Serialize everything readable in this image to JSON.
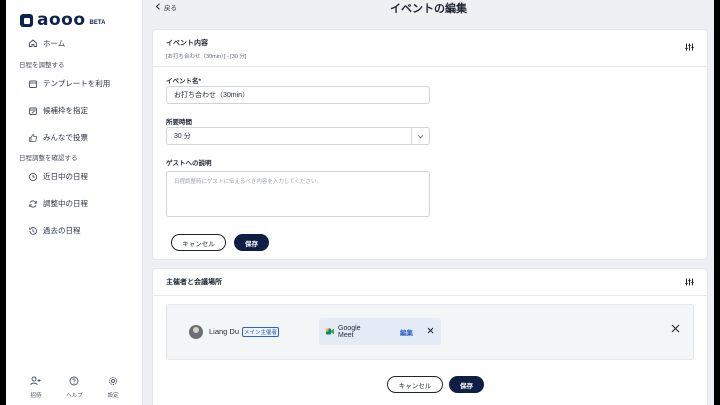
{
  "app": {
    "logo_text": "aooo",
    "logo_beta": "BETA"
  },
  "sidebar": {
    "home": "ホーム",
    "section_adjust": "日程を調整する",
    "adjust_items": [
      {
        "label": "テンプレートを利用",
        "icon": "calendar-icon"
      },
      {
        "label": "候補枠を指定",
        "icon": "calendar-edit-icon"
      },
      {
        "label": "みんなで投票",
        "icon": "thumbs-up-icon"
      }
    ],
    "section_confirm": "日程調整を確認する",
    "confirm_items": [
      {
        "label": "近日中の日程",
        "icon": "clock-icon"
      },
      {
        "label": "調整中の日程",
        "icon": "sync-icon"
      },
      {
        "label": "過去の日程",
        "icon": "history-icon"
      }
    ],
    "bottom": [
      {
        "label": "招待",
        "icon": "invite-icon"
      },
      {
        "label": "ヘルプ",
        "icon": "help-icon"
      },
      {
        "label": "設定",
        "icon": "gear-icon"
      }
    ]
  },
  "header": {
    "back_label": "戻る",
    "title": "イベントの編集"
  },
  "event_card": {
    "title": "イベント内容",
    "subtitle": "[お打ち合わせ（30min）] - [30 分]",
    "name_label": "イベント名*",
    "name_value": "お打ち合わせ（30min）",
    "duration_label": "所要時間",
    "duration_value": "30 分",
    "guest_desc_label": "ゲストへの説明",
    "guest_desc_placeholder": "日程調整時にゲストに伝えるべき内容を入力してください。",
    "cancel_label": "キャンセル",
    "save_label": "保存"
  },
  "host_card": {
    "title": "主催者と会議場所",
    "host_name": "Liang Du",
    "host_badge": "メイン主催者",
    "location_label": "Google Meet",
    "edit_label": "編集",
    "cancel_label": "キャンセル",
    "save_label": "保存"
  },
  "colors": {
    "brand": "#0f2350",
    "primary_button": "#0f1e45",
    "link": "#2563c9",
    "background": "#eef0f3"
  }
}
